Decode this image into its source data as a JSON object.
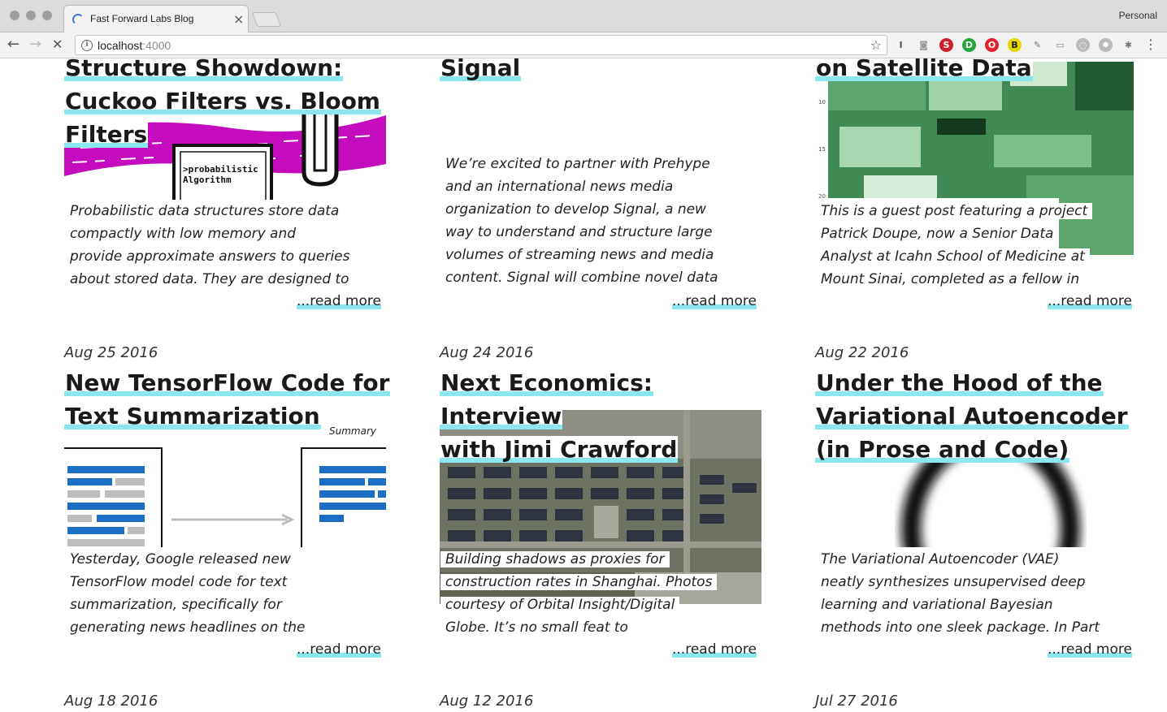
{
  "browser": {
    "tab_title": "Fast Forward Labs Blog",
    "tab_close": "×",
    "profile": "Personal",
    "url_host": "localhost",
    "url_port": ":4000",
    "back": "←",
    "forward": "→",
    "stop": "✕",
    "star": "☆",
    "menu": "⋮",
    "extensions": [
      {
        "name": "I",
        "color": "#555555"
      },
      {
        "name": "◙",
        "color": "#9a9a9a"
      },
      {
        "name": "S",
        "color": "#d0202a"
      },
      {
        "name": "D",
        "color": "#23a63b"
      },
      {
        "name": "O",
        "color": "#e5202b"
      },
      {
        "name": "B",
        "color": "#e8d400"
      },
      {
        "name": "✎",
        "color": "#777777"
      },
      {
        "name": "▭",
        "color": "#888888"
      },
      {
        "name": "◌",
        "color": "#bbbbbb"
      },
      {
        "name": "✹",
        "color": "#bbbbbb"
      },
      {
        "name": "✱",
        "color": "#777777"
      }
    ]
  },
  "posts": [
    {
      "date": "",
      "title_lines": [
        "Structure Showdown:",
        "Cuckoo Filters vs. Bloom",
        "Filters"
      ],
      "excerpt_lines": [
        "Probabilistic data structures store data",
        "compactly with low memory and",
        "provide approximate answers to queries",
        "about stored data. They are designed to"
      ],
      "read_more": "...read more",
      "image_text": ">probabilistic Algorithm"
    },
    {
      "date": "",
      "title_lines": [
        "Signal"
      ],
      "excerpt_lines": [
        "We’re excited to partner with Prehype",
        "and an international news media",
        "organization to develop Signal, a new",
        "way to understand and structure large",
        "volumes of streaming news and media",
        "content. Signal will combine novel data"
      ],
      "read_more": "...read more",
      "image_text": ""
    },
    {
      "date": "",
      "title_lines": [
        "on Satellite Data"
      ],
      "excerpt_lines": [
        "This is a guest post featuring a project",
        "Patrick Doupe, now a Senior Data",
        "Analyst at Icahn School of Medicine at",
        "Mount Sinai, completed as a fellow in"
      ],
      "read_more": "...read more",
      "image_text": ""
    },
    {
      "date": "Aug 25 2016",
      "title_lines": [
        "New TensorFlow Code for",
        "Text Summarization"
      ],
      "excerpt_lines": [
        "Yesterday, Google released new",
        "TensorFlow model code for text",
        "summarization, specifically for",
        "generating news headlines on the"
      ],
      "read_more": "...read more",
      "image_text": "Summary"
    },
    {
      "date": "Aug 24 2016",
      "title_lines": [
        "Next Economics: Interview",
        "with Jimi Crawford"
      ],
      "excerpt_lines": [
        "Building shadows as proxies for",
        "construction rates in Shanghai. Photos",
        "courtesy of Orbital Insight/Digital",
        "Globe.  It’s no small feat to"
      ],
      "read_more": "...read more",
      "image_text": ""
    },
    {
      "date": "Aug 22 2016",
      "title_lines": [
        "Under the Hood of the",
        "Variational Autoencoder",
        "(in Prose and Code)"
      ],
      "excerpt_lines": [
        "The Variational Autoencoder (VAE)",
        "neatly synthesizes unsupervised deep",
        "learning and variational Bayesian",
        "methods into one sleek package. In Part"
      ],
      "read_more": "...read more",
      "image_text": ""
    }
  ],
  "next_dates": [
    "Aug 18 2016",
    "Aug 12 2016",
    "Jul 27 2016"
  ]
}
